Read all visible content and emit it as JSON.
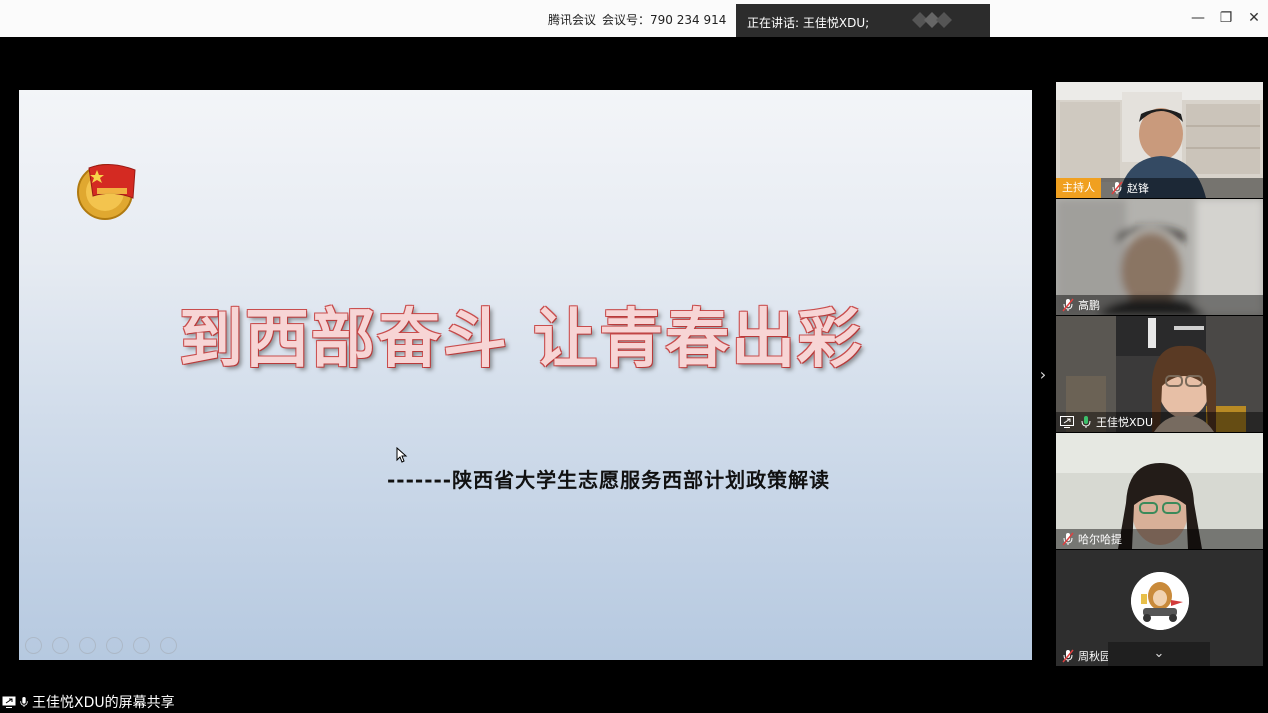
{
  "titlebar": {
    "app_name": "腾讯会议",
    "meeting_id_label": "会议号：790 234 914",
    "speaking": "正在讲话: 王佳悦XDU;",
    "minimize": "—",
    "restore": "❐",
    "close": "✕"
  },
  "slide": {
    "title": "到西部奋斗 让青春出彩",
    "subtitle": "-------陕西省大学生志愿服务西部计划政策解读"
  },
  "participants": [
    {
      "name": "赵锋",
      "badge": "主持人",
      "mic": "muted"
    },
    {
      "name": "高鹏",
      "mic": "muted"
    },
    {
      "name": "王佳悦XDU",
      "mic": "active",
      "sharing": true
    },
    {
      "name": "哈尔哈提",
      "mic": "muted"
    },
    {
      "name": "周秋园",
      "mic": "muted"
    }
  ],
  "panel_toggle": "›",
  "tiles_more": "⌄",
  "status": {
    "share_text": "王佳悦XDU的屏幕共享"
  },
  "colors": {
    "host_badge": "#f0a020",
    "mic_active": "#3cc06b",
    "mic_muted": "#e04040"
  }
}
